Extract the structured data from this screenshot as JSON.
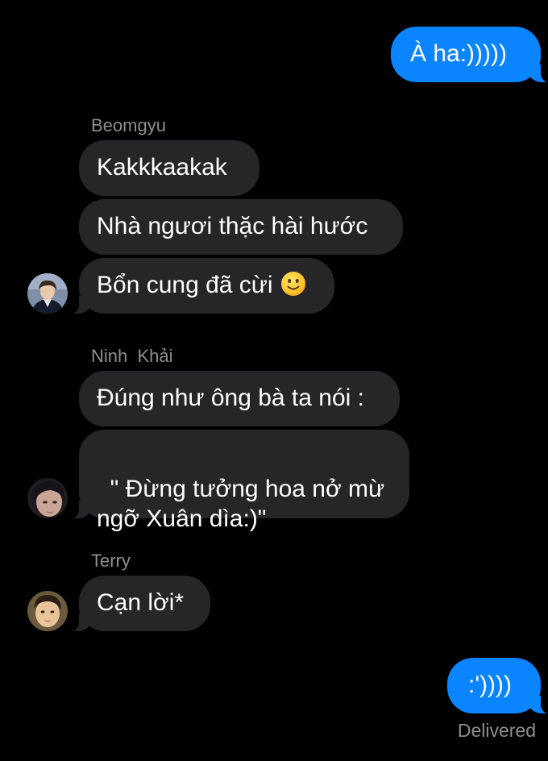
{
  "messages": {
    "m1": "À ha:)))))",
    "m2": "Kakkkaakak",
    "m3": "Nhà ngươi thặc hài hước",
    "m4": "Bổn cung đã cừi",
    "m5": "Đúng như ông bà ta nói :",
    "m6": "\" Đừng tưởng hoa nở mừ\nngỡ Xuân dìa:)\"",
    "m7": "Cạn lời*",
    "m8": ":')))) "
  },
  "senders": {
    "s1": "Beomgyu",
    "s2": "Ninh  Khải",
    "s3": "Terry"
  },
  "icons": {
    "m4_emoji": "slightly-smiling-face-emoji"
  },
  "status": {
    "delivered": "Delivered"
  },
  "colors": {
    "background": "#000000",
    "outgoing_bubble": "#0b84ff",
    "incoming_bubble": "#262629",
    "secondary_text": "#8e8e93"
  }
}
